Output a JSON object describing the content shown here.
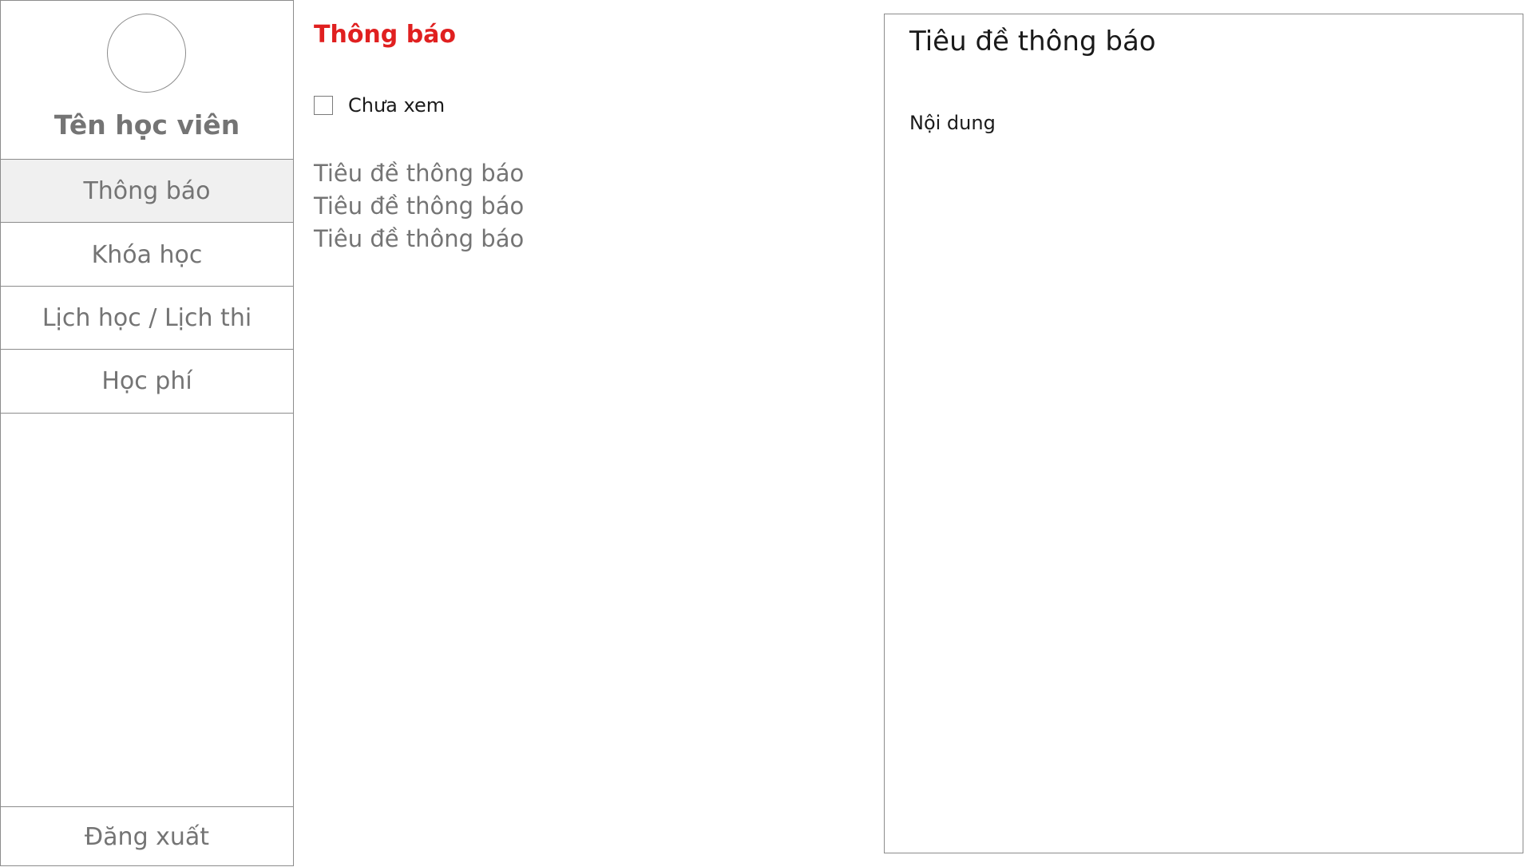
{
  "sidebar": {
    "student_name": "Tên học viên",
    "nav": [
      {
        "label": "Thông báo",
        "active": true
      },
      {
        "label": "Khóa học",
        "active": false
      },
      {
        "label": "Lịch học / Lịch thi",
        "active": false
      },
      {
        "label": "Học phí",
        "active": false
      }
    ],
    "logout_label": "Đăng xuất"
  },
  "notifications": {
    "heading": "Thông báo",
    "filter_label": "Chưa xem",
    "filter_checked": false,
    "items": [
      "Tiêu đề thông báo",
      "Tiêu đề thông báo",
      "Tiêu đề thông báo"
    ]
  },
  "detail": {
    "title": "Tiêu đề thông báo",
    "body": "Nội dung"
  },
  "colors": {
    "accent": "#e02020",
    "border": "#8c8c8c",
    "muted_text": "#747474",
    "active_bg": "#f0f0f0"
  }
}
